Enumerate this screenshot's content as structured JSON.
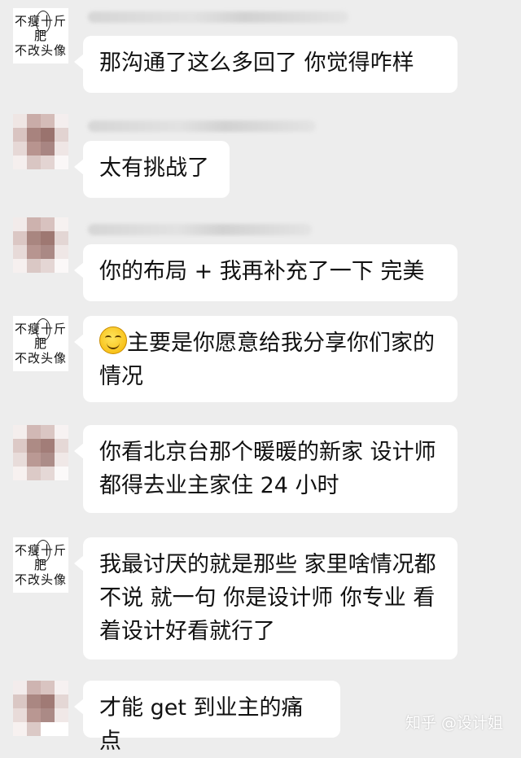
{
  "avatar_text": [
    "不瘦十斤",
    "肥",
    "不改头像"
  ],
  "messages": [
    {
      "text": "那沟通了这么多回了  你觉得咋样"
    },
    {
      "text": "太有挑战了"
    },
    {
      "text": "你的布局 + 我再补充了一下  完美"
    },
    {
      "text": "主要是你愿意给我分享你们家的情况",
      "emoji": "smiling-face-icon"
    },
    {
      "text": "你看北京台那个暖暖的新家  设计师都得去业主家住 24 小时"
    },
    {
      "text": "我最讨厌的就是那些  家里啥情况都不说  就一句  你是设计师  你专业  看着设计好看就行了"
    },
    {
      "text": "才能 get 到业主的痛点"
    }
  ],
  "watermark": "知乎 @设计姐",
  "colors": {
    "background": "#ededed",
    "bubble": "#ffffff",
    "text": "#111111"
  }
}
